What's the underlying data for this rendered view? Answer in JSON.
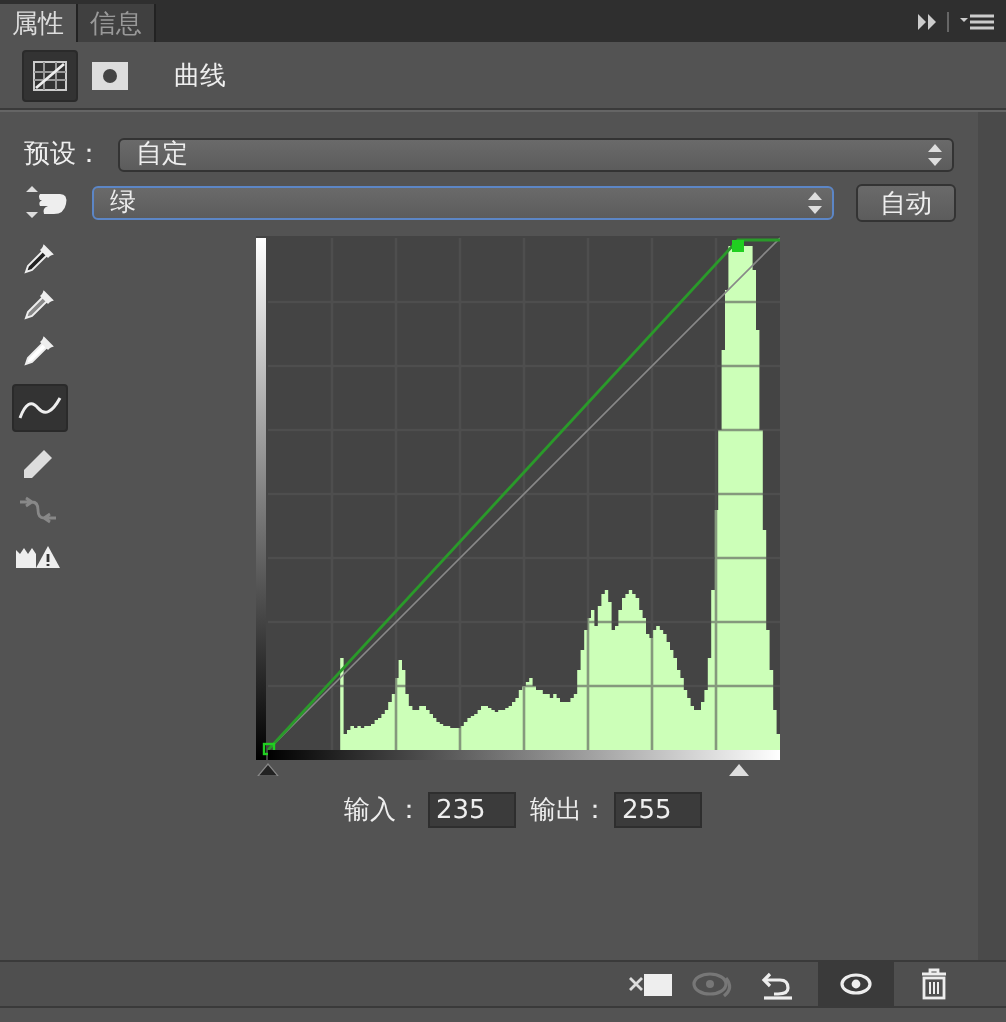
{
  "tabs": [
    {
      "label": "属性",
      "selected": true
    },
    {
      "label": "信息",
      "selected": false
    }
  ],
  "header": {
    "title": "曲线"
  },
  "preset": {
    "label": "预设：",
    "value": "自定"
  },
  "channel": {
    "value": "绿"
  },
  "auto_button": "自动",
  "tools": [
    {
      "kind": "black-dropper",
      "selected": false
    },
    {
      "kind": "gray-dropper",
      "selected": false
    },
    {
      "kind": "white-dropper",
      "selected": false
    },
    {
      "kind": "curve",
      "selected": true
    },
    {
      "kind": "pencil",
      "selected": false
    },
    {
      "kind": "smooth",
      "selected": false
    },
    {
      "kind": "clip-warning",
      "selected": false
    }
  ],
  "input_sliders": [
    {
      "level": 0
    },
    {
      "level": 0.92
    }
  ],
  "input": {
    "label": "输入：",
    "value": "235"
  },
  "output": {
    "label": "输出：",
    "value": "255"
  },
  "footer": {
    "visibility_on": true
  }
}
